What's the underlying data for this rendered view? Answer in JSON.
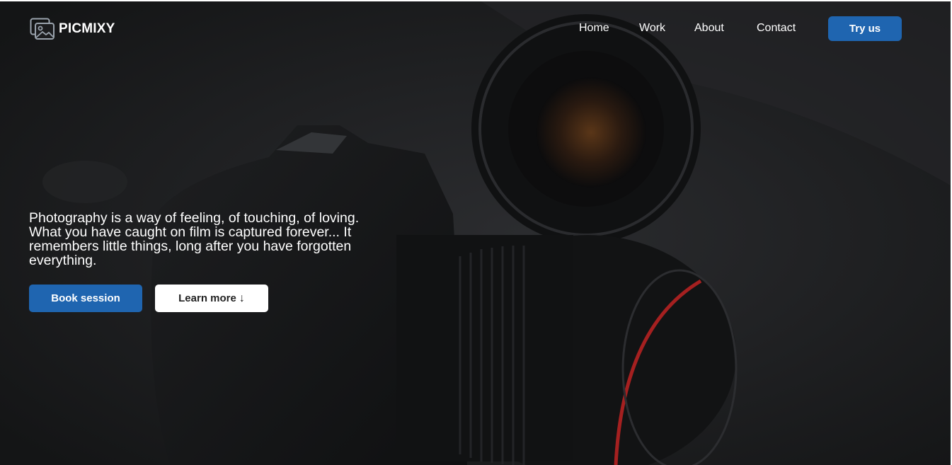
{
  "brand": {
    "name": "PICMIXY",
    "icon": "image-gallery-icon"
  },
  "nav": {
    "links": [
      "Home",
      "Work",
      "About",
      "Contact"
    ],
    "cta": "Try us"
  },
  "hero": {
    "quote": "Photography is a way of feeling, of touching, of loving. What you have caught on film is captured forever... It remembers little things, long after you have forgotten everything.",
    "primary_button": "Book session",
    "secondary_button": "Learn more",
    "secondary_icon": "↓"
  },
  "colors": {
    "accent": "#1f65b0",
    "background": "#1b1c1e",
    "text": "#ffffff"
  }
}
